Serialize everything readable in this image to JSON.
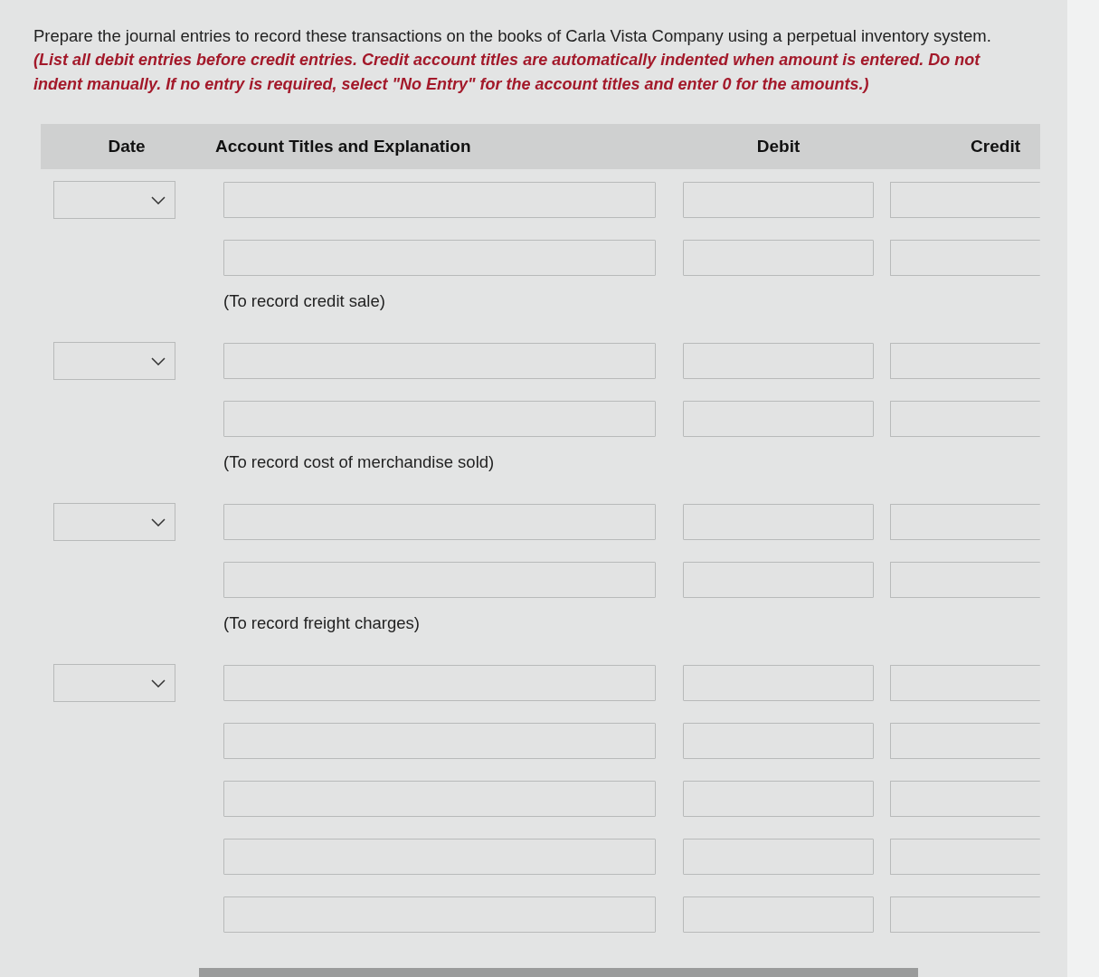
{
  "instructions": {
    "text": "Prepare the journal entries to record these transactions on the books of Carla Vista Company using a perpetual inventory system.",
    "note": "(List all debit entries before credit entries. Credit account titles are automatically indented when amount is entered. Do not indent manually. If no entry is required, select \"No Entry\" for the account titles and enter 0 for the amounts.)"
  },
  "table": {
    "columns": [
      "Date",
      "Account Titles and Explanation",
      "Debit",
      "Credit"
    ],
    "entries": [
      {
        "date_select": {
          "expanded": false
        },
        "lines": [
          {
            "kind": "blank"
          },
          {
            "kind": "blank"
          }
        ],
        "explanation": "(To record credit sale)"
      },
      {
        "date_select": {
          "expanded": false
        },
        "lines": [
          {
            "kind": "blank"
          },
          {
            "kind": "blank"
          }
        ],
        "explanation": "(To record cost of merchandise sold)"
      },
      {
        "date_select": {
          "expanded": false
        },
        "lines": [
          {
            "kind": "blank"
          },
          {
            "kind": "blank"
          }
        ],
        "explanation": "(To record freight charges)"
      },
      {
        "date_select": {
          "expanded": false
        },
        "lines": [
          {
            "kind": "blank"
          },
          {
            "kind": "blank"
          },
          {
            "kind": "blank"
          },
          {
            "kind": "blank"
          },
          {
            "kind": "blank"
          }
        ]
      }
    ]
  }
}
